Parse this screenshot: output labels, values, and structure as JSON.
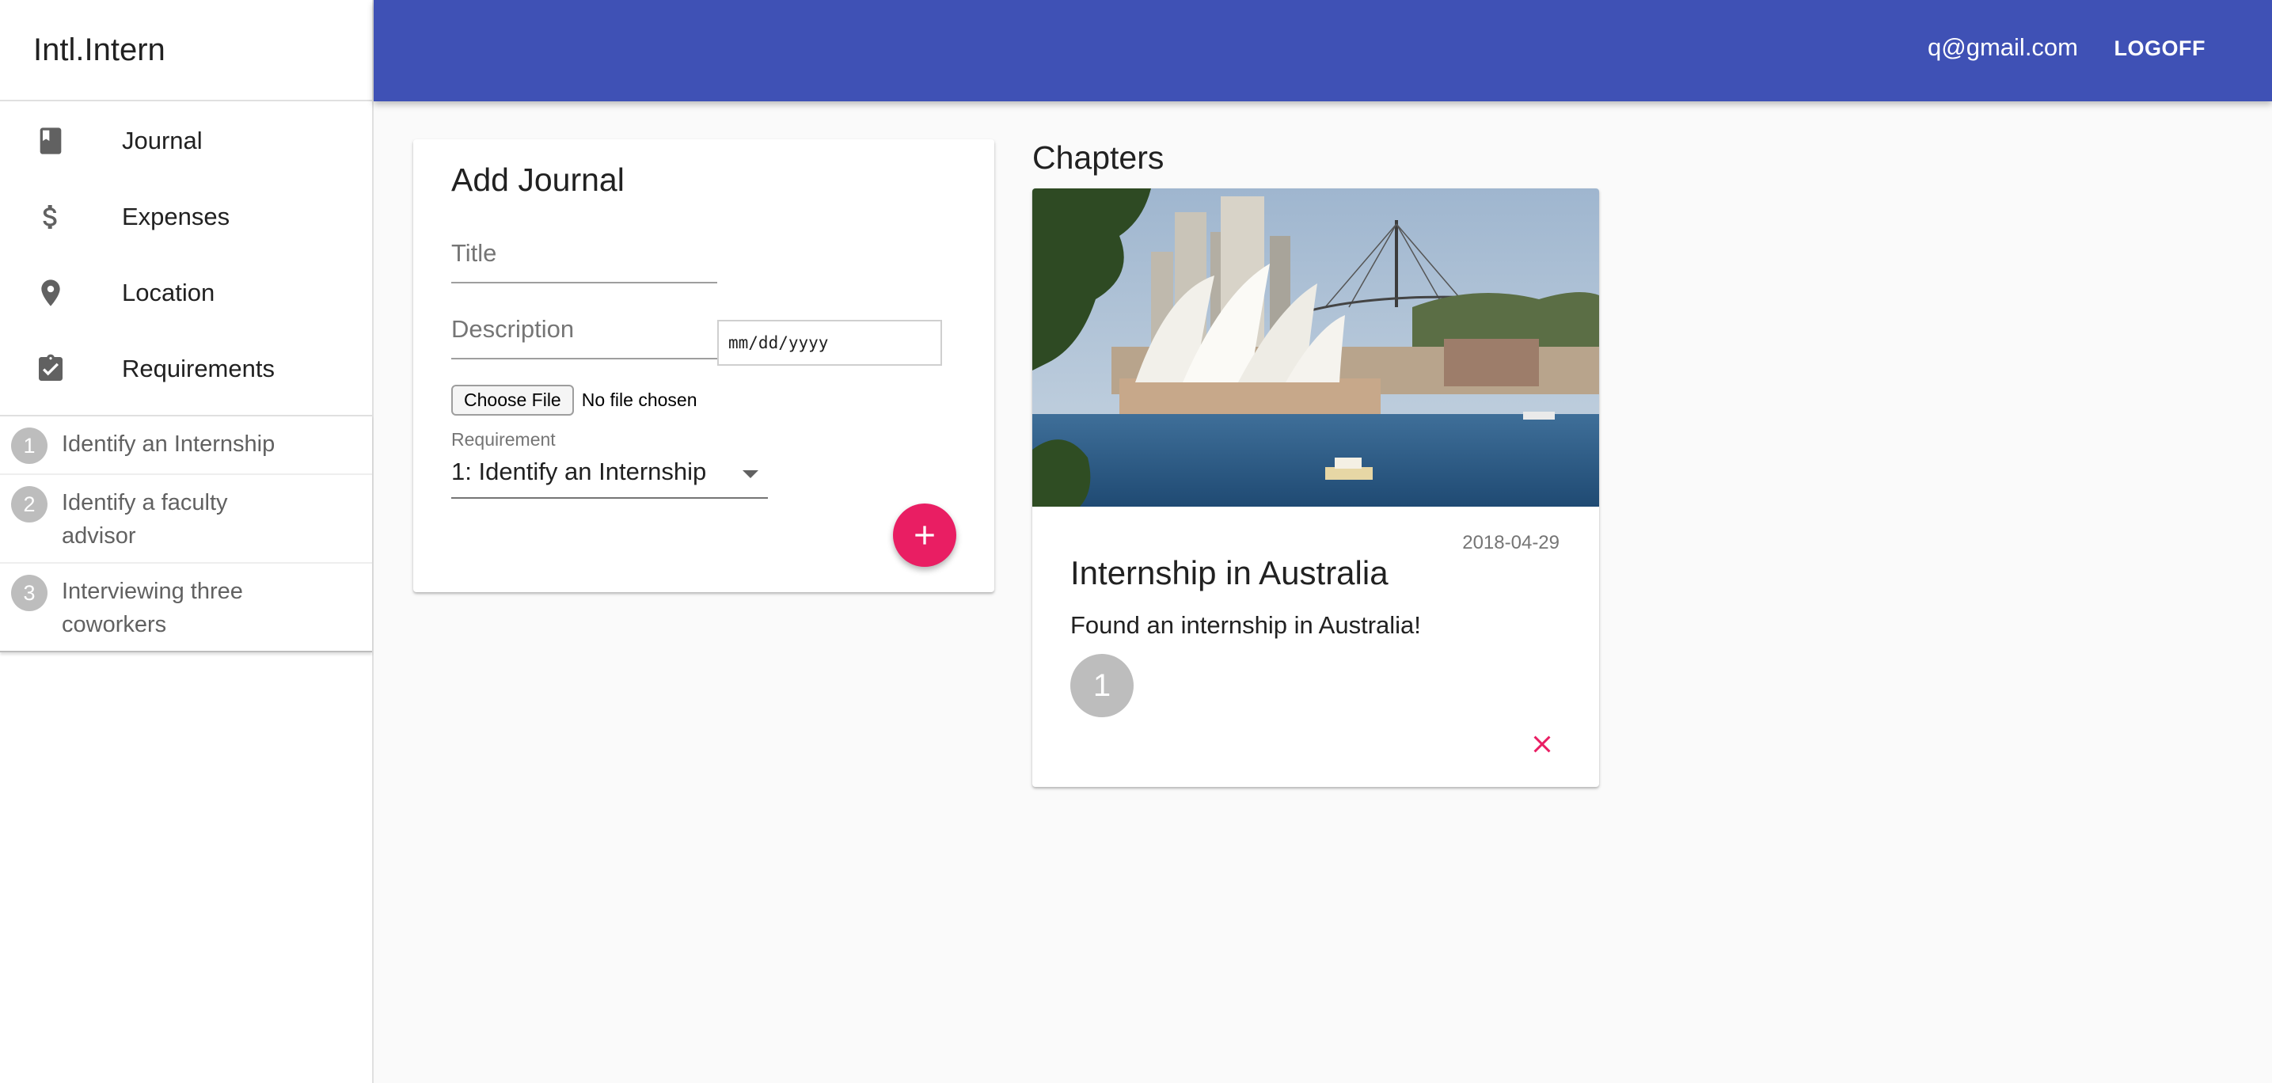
{
  "app": {
    "brand": "Intl.Intern"
  },
  "header": {
    "email": "q@gmail.com",
    "logoff_label": "LOGOFF"
  },
  "sidebar": {
    "items": [
      {
        "label": "Journal",
        "icon": "book-icon"
      },
      {
        "label": "Expenses",
        "icon": "dollar-icon"
      },
      {
        "label": "Location",
        "icon": "location-pin-icon"
      },
      {
        "label": "Requirements",
        "icon": "clipboard-check-icon"
      }
    ],
    "requirements": [
      {
        "num": "1",
        "text": "Identify an Internship"
      },
      {
        "num": "2",
        "text": "Identify a faculty advisor"
      },
      {
        "num": "3",
        "text": "Interviewing three coworkers"
      }
    ]
  },
  "add_journal": {
    "title": "Add Journal",
    "title_placeholder": "Title",
    "description_placeholder": "Description",
    "date_placeholder": "mm/dd/yyyy",
    "file_button": "Choose File",
    "file_status": "No file chosen",
    "requirement_label": "Requirement",
    "requirement_value": "1: Identify an Internship"
  },
  "chapters": {
    "heading": "Chapters",
    "items": [
      {
        "date": "2018-04-29",
        "title": "Internship in Australia",
        "description": "Found an internship in Australia!",
        "badge": "1",
        "image": "sydney-opera-house-photo"
      }
    ]
  },
  "colors": {
    "primary": "#3f51b5",
    "accent": "#e91e63",
    "badge": "#bdbdbd"
  }
}
